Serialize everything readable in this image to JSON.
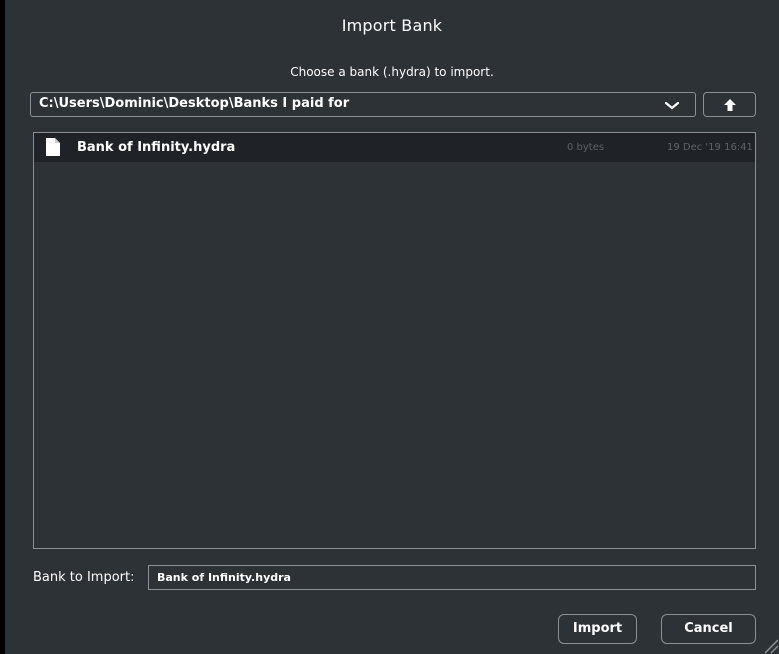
{
  "dialog": {
    "title": "Import Bank",
    "subtitle": "Choose a bank (.hydra) to import."
  },
  "path_bar": {
    "current_path": "C:\\Users\\Dominic\\Desktop\\Banks I paid for",
    "dropdown_icon": "chevron-down-icon",
    "up_icon": "arrow-up-icon"
  },
  "file_list": {
    "items": [
      {
        "icon": "file-icon",
        "name": "Bank of Infinity.hydra",
        "size": "0 bytes",
        "date": "19 Dec '19 16:41",
        "selected": true
      }
    ]
  },
  "bank_to_import": {
    "label": "Bank to Import:",
    "value": "Bank of Infinity.hydra"
  },
  "buttons": {
    "import_label": "Import",
    "cancel_label": "Cancel"
  },
  "colors": {
    "background": "#2d3237",
    "selected_row": "#1f2327",
    "border": "#8a9095",
    "text": "#ffffff",
    "muted_text": "#5c6268"
  }
}
